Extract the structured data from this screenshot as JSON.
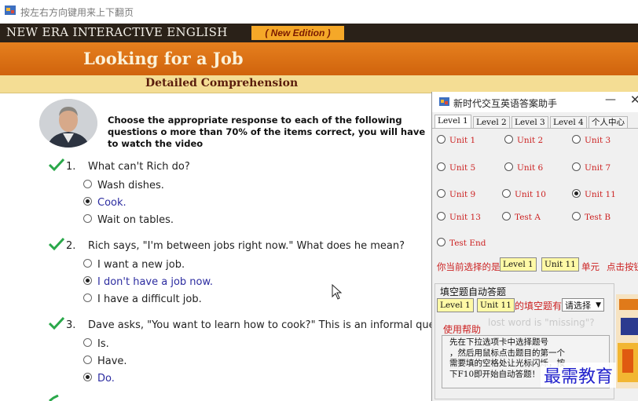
{
  "window": {
    "title": "按左右方向键用来上下翻页"
  },
  "header": {
    "brand": "NEW ERA INTERACTIVE ENGLISH",
    "edition": "( New Edition )",
    "lesson_title": "Looking for a Job",
    "section_title": "Detailed Comprehension"
  },
  "instructions": "Choose the appropriate response to each of the following questions o more than 70% of the items correct, you will have to watch the video",
  "questions": [
    {
      "num": "1.",
      "text": "What can't Rich do?",
      "options": [
        {
          "label": "Wash dishes.",
          "selected": false
        },
        {
          "label": "Cook.",
          "selected": true
        },
        {
          "label": "Wait on tables.",
          "selected": false
        }
      ]
    },
    {
      "num": "2.",
      "text": "Rich says, \"I'm between jobs right now.\" What does he mean?",
      "options": [
        {
          "label": "I want a new job.",
          "selected": false
        },
        {
          "label": "I don't have a job now.",
          "selected": true
        },
        {
          "label": "I have a difficult job.",
          "selected": false
        }
      ]
    },
    {
      "num": "3.",
      "text": "Dave asks, \"You want to learn how to cook?\" This is an informal que",
      "options": [
        {
          "label": "Is.",
          "selected": false
        },
        {
          "label": "Have.",
          "selected": false
        },
        {
          "label": "Do.",
          "selected": true
        }
      ]
    }
  ],
  "helper": {
    "title": "新时代交互英语答案助手",
    "min_symbol": "—",
    "close_symbol": "✕",
    "tabs": [
      "Level 1",
      "Level 2",
      "Level 3",
      "Level 4",
      "个人中心"
    ],
    "active_tab": 0,
    "units": [
      {
        "label": "Unit 1",
        "selected": false
      },
      {
        "label": "Unit 2",
        "selected": false
      },
      {
        "label": "Unit 3",
        "selected": false
      },
      {
        "label": "Unit 5",
        "selected": false
      },
      {
        "label": "Unit 6",
        "selected": false
      },
      {
        "label": "Unit 7",
        "selected": false
      },
      {
        "label": "Unit 9",
        "selected": false
      },
      {
        "label": "Unit 10",
        "selected": false
      },
      {
        "label": "Unit 11",
        "selected": true
      },
      {
        "label": "Unit 13",
        "selected": false
      },
      {
        "label": "Test A",
        "selected": false
      },
      {
        "label": "Test B",
        "selected": false
      },
      {
        "label": "Test End",
        "selected": false
      }
    ],
    "selection": {
      "prefix": "你当前选择的是",
      "level": "Level 1",
      "unit": "Unit 11",
      "suffix": "单元",
      "hint": "点击按钮"
    },
    "fill": {
      "group_title": "填空题自动答题",
      "level": "Level 1",
      "unit": "Unit 11",
      "mid_text": "的填空题有",
      "select_value": "请选择"
    },
    "help": {
      "label": "使用帮助",
      "lines": [
        "先在下拉选项卡中选择题号",
        "，然后用鼠标点击题目的第一个",
        "需要填的空格处让光标闪烁，按",
        "下F10即开始自动答题！"
      ]
    },
    "background_text": "lost word is \"missing\"?"
  },
  "watermark": "最需教育",
  "colors": {
    "banner_dark": "#2a2118",
    "banner_orange": "#d9701a",
    "band_yellow": "#f4dd94",
    "check_green": "#2aa84a",
    "accent_red": "#cc2222"
  }
}
